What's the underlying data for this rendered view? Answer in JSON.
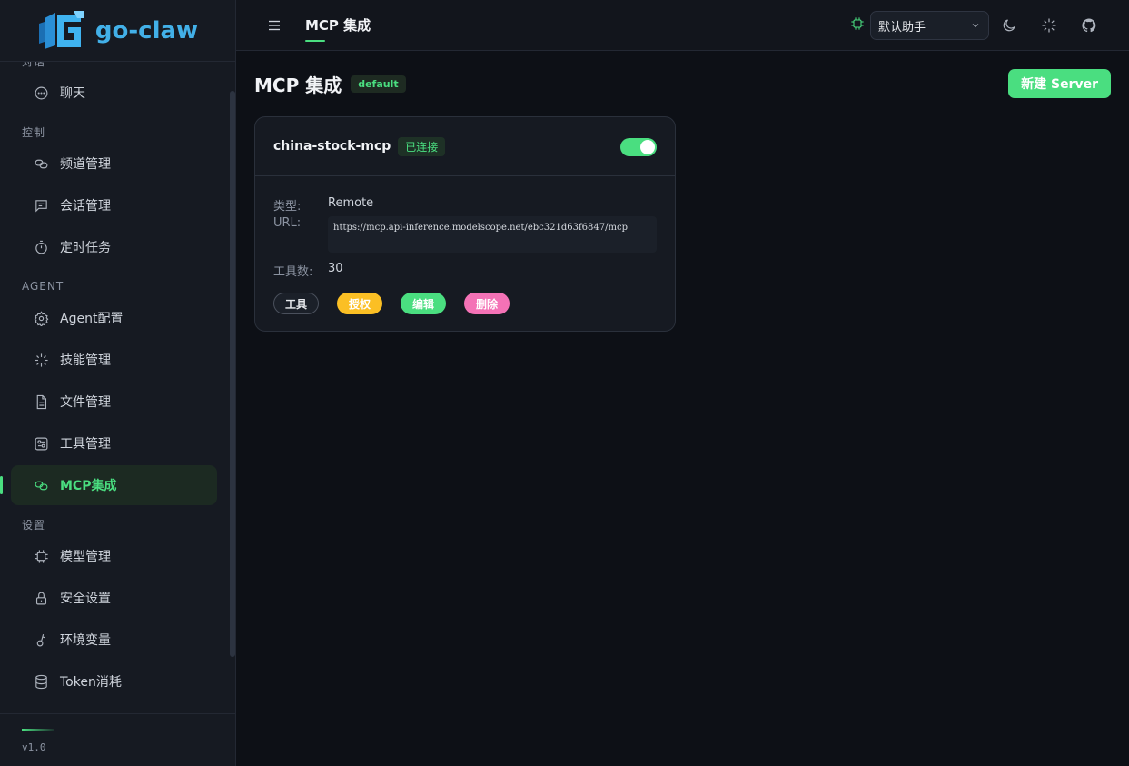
{
  "app": {
    "logo_text": "go-claw",
    "version": "v1.0"
  },
  "sidebar": {
    "partial_group": "对话",
    "groups": [
      {
        "label": "",
        "items": [
          {
            "label": "聊天",
            "icon": "chat-icon"
          }
        ]
      },
      {
        "label": "控制",
        "items": [
          {
            "label": "频道管理",
            "icon": "link-icon"
          },
          {
            "label": "会话管理",
            "icon": "message-square-icon"
          },
          {
            "label": "定时任务",
            "icon": "timer-icon"
          }
        ]
      },
      {
        "label": "AGENT",
        "items": [
          {
            "label": "Agent配置",
            "icon": "gear-icon"
          },
          {
            "label": "技能管理",
            "icon": "sparkle-icon"
          },
          {
            "label": "文件管理",
            "icon": "file-icon"
          },
          {
            "label": "工具管理",
            "icon": "toolbox-icon"
          },
          {
            "label": "MCP集成",
            "icon": "link-icon",
            "active": true
          }
        ]
      },
      {
        "label": "设置",
        "items": [
          {
            "label": "模型管理",
            "icon": "cpu-icon"
          },
          {
            "label": "安全设置",
            "icon": "lock-icon"
          },
          {
            "label": "环境变量",
            "icon": "key-icon"
          },
          {
            "label": "Token消耗",
            "icon": "database-icon"
          }
        ]
      }
    ]
  },
  "topbar": {
    "title": "MCP 集成",
    "assistant": "默认助手"
  },
  "page": {
    "title": "MCP 集成",
    "badge": "default",
    "new_button": "新建 Server"
  },
  "server": {
    "name": "china-stock-mcp",
    "status": "已连接",
    "enabled": true,
    "type_label": "类型:",
    "type_value": "Remote",
    "url_label": "URL:",
    "url_value": "https://mcp.api-inference.modelscope.net/ebc321d63f6847/mcp",
    "tools_label": "工具数:",
    "tools_value": "30",
    "actions": {
      "tools": "工具",
      "auth": "授权",
      "edit": "编辑",
      "delete": "删除"
    }
  },
  "colors": {
    "accent": "#4ade80",
    "auth": "#fbbf24",
    "delete": "#f472b6",
    "logo": "#42b0e8"
  }
}
